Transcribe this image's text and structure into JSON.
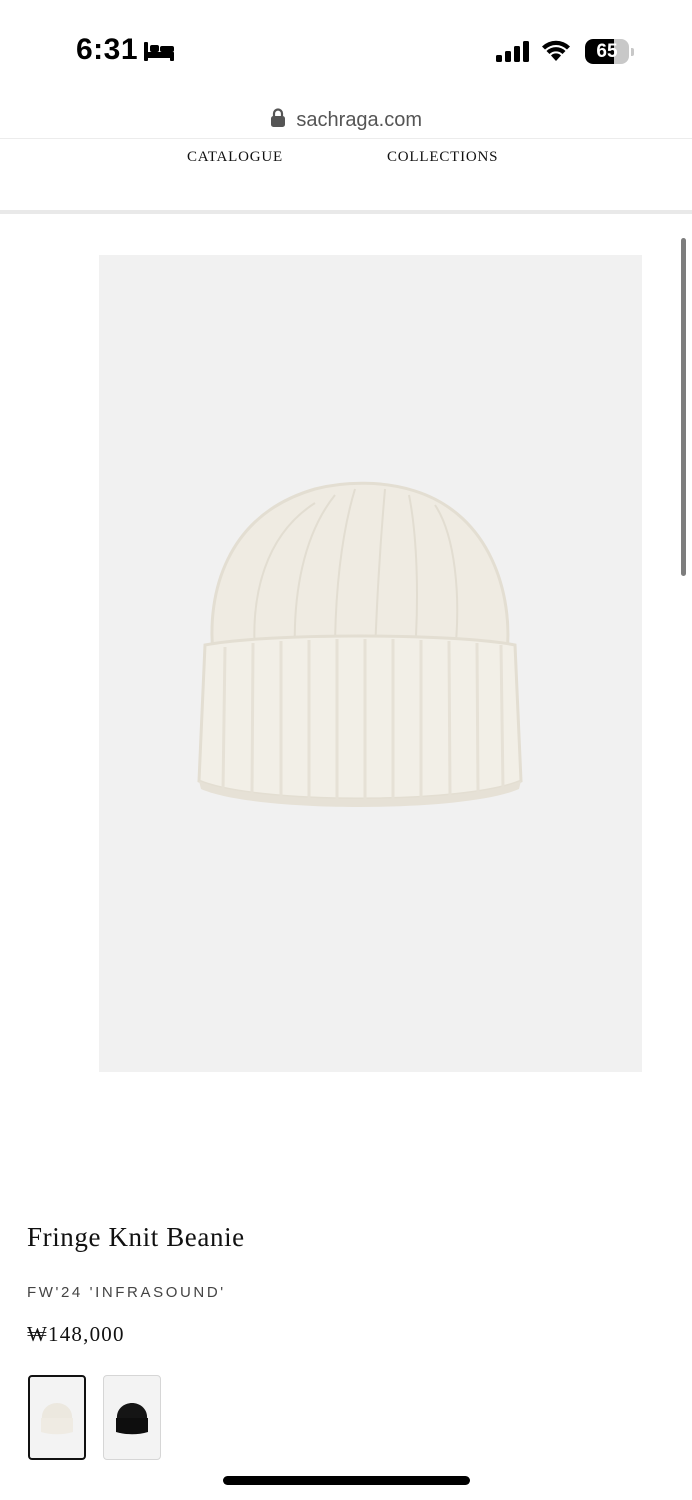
{
  "status_bar": {
    "time": "6:31",
    "battery_level": "65",
    "battery_fraction": 0.65,
    "sleep_icon": "bed-icon",
    "signal_icon": "cellular-signal-icon",
    "wifi_icon": "wifi-icon"
  },
  "browser": {
    "url": "sachraga.com",
    "lock_icon": "lock-icon"
  },
  "nav": {
    "items": [
      {
        "label": "CATALOGUE"
      },
      {
        "label": "COLLECTIONS"
      }
    ]
  },
  "product": {
    "image_icon": "beanie-image",
    "title": "Fringe Knit Beanie",
    "collection": "FW'24 'INFRASOUND'",
    "price": "₩148,000",
    "swatches": [
      {
        "name": "ivory",
        "color": "#ece8df",
        "selected": true
      },
      {
        "name": "black",
        "color": "#111111",
        "selected": false
      }
    ]
  },
  "colors": {
    "image_background": "#f1f1f1",
    "text": "#111111",
    "muted_text": "#444444"
  }
}
